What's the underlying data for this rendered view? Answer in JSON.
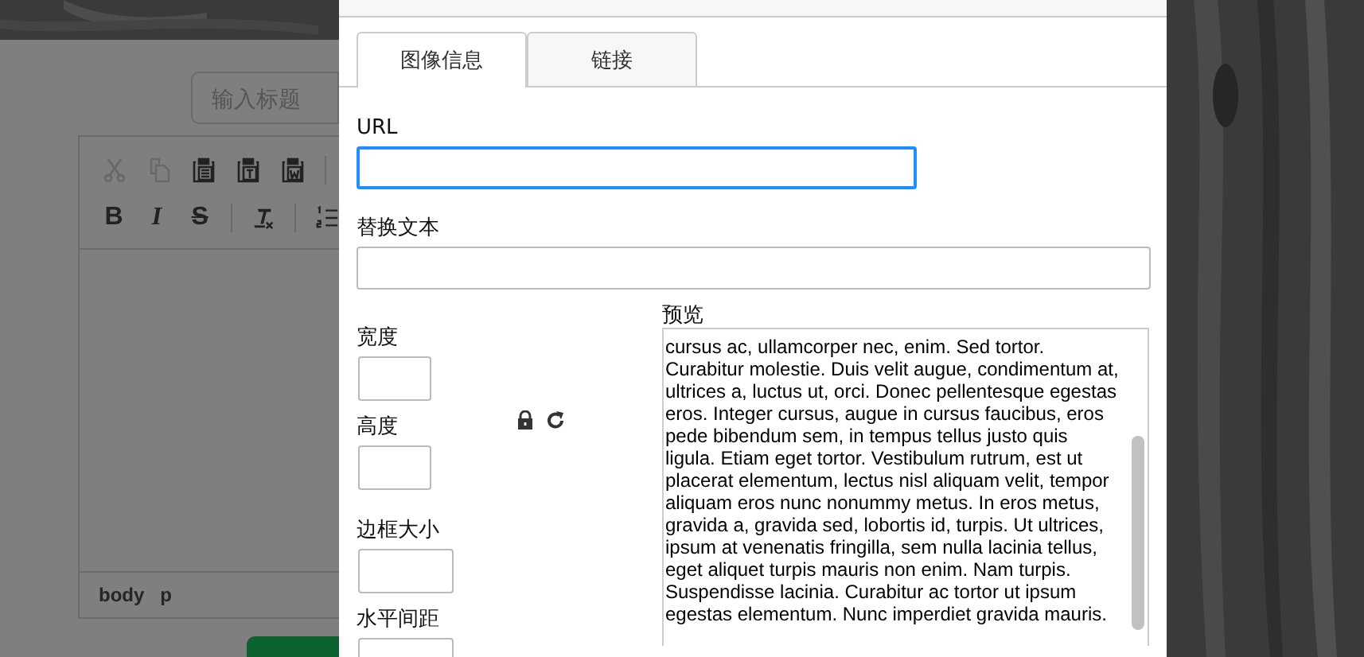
{
  "page": {
    "title_field": {
      "placeholder": "输入标题"
    },
    "toolbar_rows": [
      [
        {
          "kind": "cut",
          "disabled": true
        },
        {
          "kind": "copy",
          "disabled": true
        },
        {
          "kind": "paste",
          "disabled": false
        },
        {
          "kind": "paste-text",
          "disabled": false
        },
        {
          "kind": "paste-word",
          "disabled": false
        },
        {
          "kind": "separator"
        }
      ],
      [
        {
          "kind": "bold",
          "label": "B",
          "disabled": false
        },
        {
          "kind": "italic",
          "label": "I",
          "disabled": false
        },
        {
          "kind": "strike",
          "label": "S",
          "disabled": false
        },
        {
          "kind": "separator"
        },
        {
          "kind": "clear-format",
          "disabled": false
        },
        {
          "kind": "separator"
        },
        {
          "kind": "ordered-list",
          "disabled": false
        }
      ]
    ],
    "status_path": [
      "body",
      "p"
    ]
  },
  "dialog": {
    "tabs": [
      {
        "label": "图像信息",
        "selected": true
      },
      {
        "label": "链接",
        "selected": false
      }
    ],
    "url": {
      "label": "URL",
      "focused": true
    },
    "alt_text": {
      "label": "替换文本"
    },
    "width": {
      "label": "宽度"
    },
    "height": {
      "label": "高度"
    },
    "border": {
      "label": "边框大小"
    },
    "hspace": {
      "label": "水平间距"
    },
    "preview": {
      "label": "预览",
      "text": "cursus ac, ullamcorper nec, enim. Sed tortor. Curabitur molestie. Duis velit augue, condimentum at, ultrices a, luctus ut, orci. Donec pellentesque egestas eros. Integer cursus, augue in cursus faucibus, eros pede bibendum sem, in tempus tellus justo quis ligula. Etiam eget tortor. Vestibulum rutrum, est ut placerat elementum, lectus nisl aliquam velit, tempor aliquam eros nunc nonummy metus. In eros metus, gravida a, gravida sed, lobortis id, turpis. Ut ultrices, ipsum at venenatis fringilla, sem nulla lacinia tellus, eget aliquet turpis mauris non enim. Nam turpis. Suspendisse lacinia. Curabitur ac tortor ut ipsum egestas elementum. Nunc imperdiet gravida mauris."
    }
  }
}
